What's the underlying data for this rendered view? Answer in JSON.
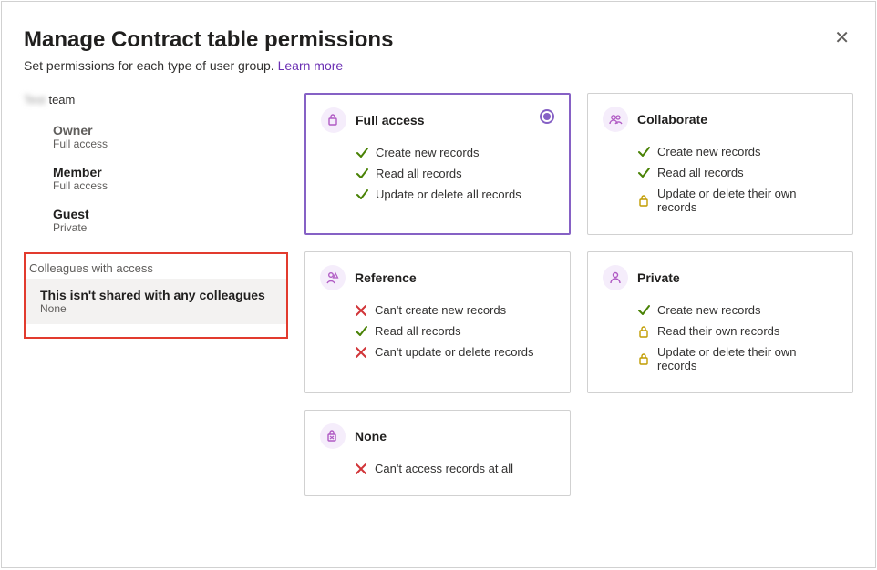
{
  "header": {
    "title": "Manage Contract table permissions",
    "subtitle_prefix": "Set permissions for each type of user group. ",
    "learn_more": "Learn more"
  },
  "sidebar": {
    "team_suffix": "team",
    "roles": [
      {
        "name": "Owner",
        "sub": "Full access",
        "muted": true
      },
      {
        "name": "Member",
        "sub": "Full access",
        "muted": false
      },
      {
        "name": "Guest",
        "sub": "Private",
        "muted": false
      }
    ],
    "colleagues_header": "Colleagues with access",
    "colleagues_item": {
      "name": "This isn't shared with any colleagues",
      "sub": "None"
    }
  },
  "cards": [
    {
      "id": "full-access",
      "title": "Full access",
      "icon": "unlock",
      "selected": true,
      "features": [
        {
          "icon": "check",
          "text": "Create new records"
        },
        {
          "icon": "check",
          "text": "Read all records"
        },
        {
          "icon": "check",
          "text": "Update or delete all records"
        }
      ]
    },
    {
      "id": "collaborate",
      "title": "Collaborate",
      "icon": "group",
      "selected": false,
      "features": [
        {
          "icon": "check",
          "text": "Create new records"
        },
        {
          "icon": "check",
          "text": "Read all records"
        },
        {
          "icon": "lock",
          "text": "Update or delete their own records"
        }
      ]
    },
    {
      "id": "reference",
      "title": "Reference",
      "icon": "person-warn",
      "selected": false,
      "features": [
        {
          "icon": "cross",
          "text": "Can't create new records"
        },
        {
          "icon": "check",
          "text": "Read all records"
        },
        {
          "icon": "cross",
          "text": "Can't update or delete records"
        }
      ]
    },
    {
      "id": "private",
      "title": "Private",
      "icon": "person",
      "selected": false,
      "features": [
        {
          "icon": "check",
          "text": "Create new records"
        },
        {
          "icon": "lock",
          "text": "Read their own records"
        },
        {
          "icon": "lock",
          "text": "Update or delete their own records"
        }
      ]
    },
    {
      "id": "none",
      "title": "None",
      "icon": "lock-x",
      "selected": false,
      "features": [
        {
          "icon": "cross",
          "text": "Can't access records at all"
        }
      ]
    }
  ]
}
